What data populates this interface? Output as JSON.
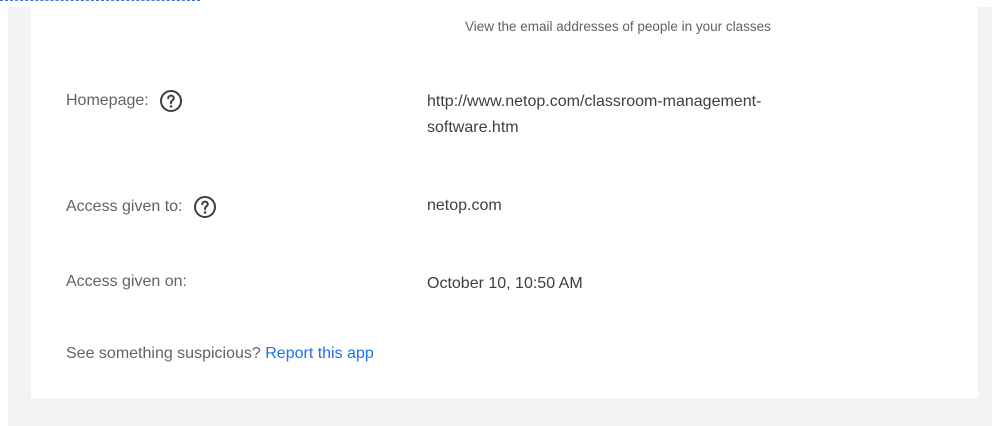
{
  "permission": {
    "scope_text": "View the email addresses of people in your classes"
  },
  "details": [
    {
      "label": "Homepage:",
      "value": "http://www.netop.com/classroom-management-\nsoftware.htm",
      "has_help": true
    },
    {
      "label": "Access given to:",
      "value": "netop.com",
      "has_help": true
    },
    {
      "label": "Access given on:",
      "value": "October 10, 10:50 AM",
      "has_help": false
    }
  ],
  "footer": {
    "prompt": "See something suspicious?",
    "link_text": "Report this app"
  },
  "icons": {
    "help": "help-circle-icon"
  },
  "colors": {
    "link": "#1a73e8",
    "label": "#5f6368",
    "value": "#3c4043",
    "background": "#f1f3f4"
  }
}
